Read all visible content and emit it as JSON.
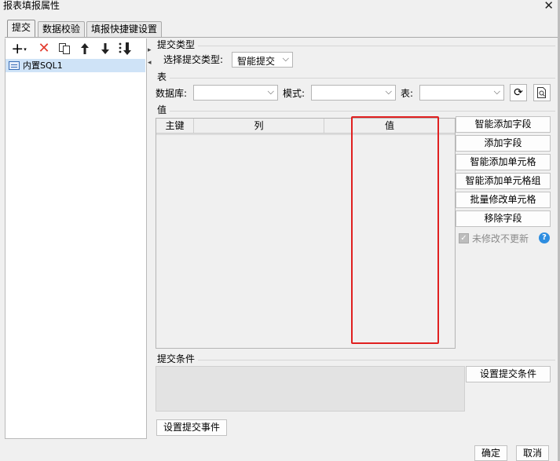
{
  "window": {
    "title": "报表填报属性"
  },
  "tabs": [
    {
      "label": "提交"
    },
    {
      "label": "数据校验"
    },
    {
      "label": "填报快捷键设置"
    }
  ],
  "tree": {
    "items": [
      {
        "label": "内置SQL1"
      }
    ]
  },
  "submit_type": {
    "section_label": "提交类型",
    "select_label": "选择提交类型:",
    "selected": "智能提交"
  },
  "table_section": {
    "section_label": "表",
    "database_label": "数据库:",
    "mode_label": "模式:",
    "table_label": "表:"
  },
  "value_section": {
    "section_label": "值",
    "columns": [
      "主键",
      "列",
      "值"
    ]
  },
  "side_buttons": [
    "智能添加字段",
    "添加字段",
    "智能添加单元格",
    "智能添加单元格组",
    "批量修改单元格",
    "移除字段"
  ],
  "no_update_unchanged": {
    "label": "未修改不更新",
    "checked": true
  },
  "condition": {
    "section_label": "提交条件",
    "button": "设置提交条件"
  },
  "event_button": "设置提交事件",
  "footer": {
    "ok": "确定",
    "cancel": "取消"
  },
  "colors": {
    "highlight_border": "#e02020",
    "selected_row": "#cfe3f7",
    "help_icon": "#2d8de0"
  }
}
